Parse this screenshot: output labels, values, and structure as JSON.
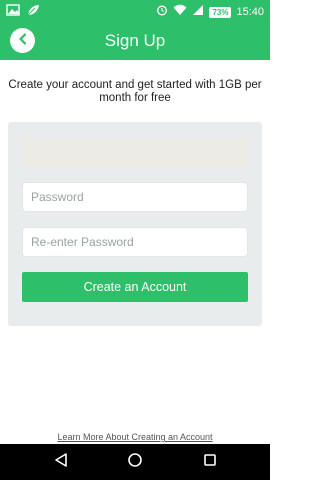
{
  "status_bar": {
    "icons_left": [
      "gallery-icon",
      "leaf-app-icon"
    ],
    "icons_right": [
      "alarm-icon",
      "wifi-icon",
      "signal-icon",
      "battery-icon"
    ],
    "battery": "73%",
    "time": "15:40"
  },
  "app_bar": {
    "title": "Sign Up",
    "back_icon": "chevron-left-icon"
  },
  "intro_text": "Create your account and get started with 1GB per month for free",
  "form": {
    "email_value": "",
    "password_placeholder": "Password",
    "reenter_placeholder": "Re-enter Password",
    "submit_label": "Create an Account"
  },
  "footer": {
    "learn_more": "Learn More About Creating an Account"
  },
  "nav": {
    "back_icon": "triangle-back-icon",
    "home_icon": "circle-home-icon",
    "recent_icon": "square-recent-icon"
  },
  "colors": {
    "primary": "#2dbf6a",
    "card_bg": "#e9ecec",
    "nav_bg": "#000000"
  }
}
